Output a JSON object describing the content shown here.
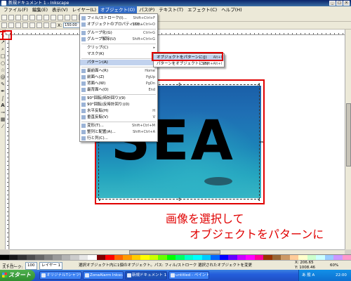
{
  "window": {
    "title": "新規ドキュメント 1 - Inkscape",
    "controls": [
      "_",
      "□",
      "×"
    ]
  },
  "menubar": [
    "ファイル(F)",
    "編集(E)",
    "表示(V)",
    "レイヤー(L)",
    "オブジェクト(O)",
    "パス(P)",
    "テキスト(T)",
    "エフェクト(C)",
    "ヘルプ(H)"
  ],
  "menubar_active_index": 4,
  "toolbar": {
    "x_label": "X:",
    "x_value": "150.00"
  },
  "object_menu": {
    "items": [
      {
        "label": "フィル/ストローク(I)...",
        "shortcut": "Shift+Ctrl+F",
        "icon": "fill-stroke-icon"
      },
      {
        "label": "オブジェクトのプロパティ(O)...",
        "shortcut": "Shift+Ctrl+O",
        "icon": "properties-icon"
      },
      {
        "label": "グループ化(G)",
        "shortcut": "Ctrl+G",
        "icon": "group-icon"
      },
      {
        "label": "グループ解除(U)",
        "shortcut": "Shift+Ctrl+G",
        "icon": "ungroup-icon"
      },
      {
        "label": "クリップ(C)",
        "shortcut": "▸",
        "icon": ""
      },
      {
        "label": "マスク(K)",
        "shortcut": "▸",
        "icon": ""
      },
      {
        "label": "パターン(A)",
        "shortcut": "▸",
        "icon": ""
      },
      {
        "label": "最前面へ(R)",
        "shortcut": "Home",
        "icon": "raise-top-icon"
      },
      {
        "label": "前面へ(Z)",
        "shortcut": "PgUp",
        "icon": "raise-icon"
      },
      {
        "label": "背面へ(W)",
        "shortcut": "PgDn",
        "icon": "lower-icon"
      },
      {
        "label": "最背面へ(O)",
        "shortcut": "End",
        "icon": "lower-bottom-icon"
      },
      {
        "label": "90°回転(時計回り)(9)",
        "shortcut": "",
        "icon": "rotate-cw-icon"
      },
      {
        "label": "90°回転(反時計回り)(0)",
        "shortcut": "",
        "icon": "rotate-ccw-icon"
      },
      {
        "label": "水平反転(H)",
        "shortcut": "H",
        "icon": "flip-h-icon"
      },
      {
        "label": "垂直反転(V)",
        "shortcut": "V",
        "icon": "flip-v-icon"
      },
      {
        "label": "変形(T)...",
        "shortcut": "Shift+Ctrl+M",
        "icon": "transform-icon"
      },
      {
        "label": "整列と配置(A)...",
        "shortcut": "Shift+Ctrl+A",
        "icon": "align-icon"
      },
      {
        "label": "行と列(C)...",
        "shortcut": "",
        "icon": "rows-cols-icon"
      }
    ]
  },
  "pattern_submenu": {
    "items": [
      {
        "label": "オブジェクトをパターンに(J)",
        "shortcut": "Alt+I"
      },
      {
        "label": "パターンをオブジェクトに(B)",
        "shortcut": "Shift+Alt+I"
      }
    ]
  },
  "canvas": {
    "image_text": "SEA"
  },
  "annotation": {
    "line1": "画像を選択して",
    "line2": "オブジェクトをパターンに"
  },
  "palette_colors": [
    "#000000",
    "#1a1a1a",
    "#333333",
    "#4d4d4d",
    "#666666",
    "#808080",
    "#999999",
    "#b3b3b3",
    "#cccccc",
    "#e6e6e6",
    "#ffffff",
    "#800000",
    "#ff0000",
    "#ff6600",
    "#ff9900",
    "#ffcc00",
    "#ffff00",
    "#ccff00",
    "#66ff00",
    "#00ff00",
    "#00ff66",
    "#00ffcc",
    "#00ffff",
    "#00ccff",
    "#0066ff",
    "#0000ff",
    "#6600ff",
    "#cc00ff",
    "#ff00ff",
    "#ff0099",
    "#993300",
    "#996633",
    "#cc9966",
    "#ffcc99",
    "#ffffcc",
    "#ccffcc",
    "#ccffff",
    "#99ccff",
    "#cc99ff",
    "#ff99cc"
  ],
  "statusbar": {
    "fill_label": "フィル:",
    "stroke_label": "ストローク:",
    "opacity_value": "100",
    "layer": "レイヤー 1",
    "message": "選択オブジェクト内に1個のオブジェクト。パス: フィル/ストローク 選択されたオブジェクトを変更",
    "zoom": "60%",
    "x": "X: 206.65",
    "y": "Y: 1008.46"
  },
  "taskbar": {
    "start": "スタート",
    "tasks": [
      {
        "label": "オリジナルTシャツ作り - 日...",
        "active": false
      },
      {
        "label": "ZoneAlarm Inkscape Page",
        "active": false
      },
      {
        "label": "新規ドキュメント 1 - Inksc...",
        "active": true
      },
      {
        "label": "untitled - ペイント",
        "active": false
      }
    ],
    "tray_label": "あ 般 A",
    "clock": "22:00"
  }
}
